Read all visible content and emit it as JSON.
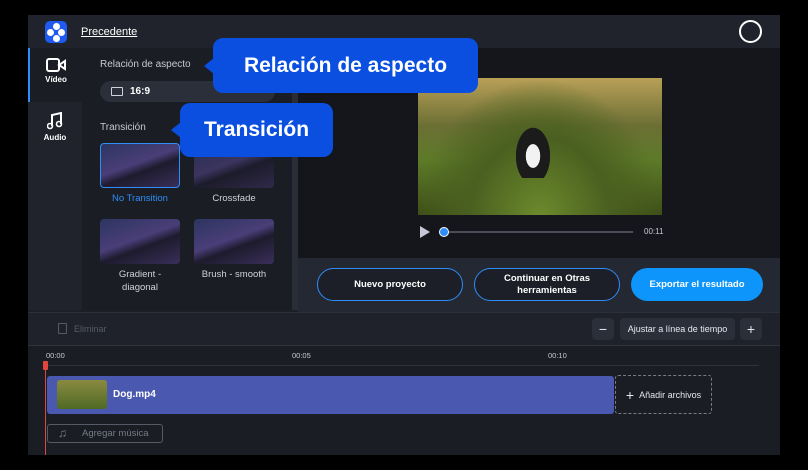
{
  "header": {
    "back_label": "Precedente"
  },
  "rail": [
    {
      "label": "Vídeo",
      "icon": "video-camera-icon"
    },
    {
      "label": "Audio",
      "icon": "music-note-icon"
    }
  ],
  "panel": {
    "aspect_label": "Relación de aspecto",
    "aspect_value": "16:9",
    "transition_label": "Transición",
    "transitions": [
      {
        "label": "No Transition",
        "selected": true
      },
      {
        "label": "Crossfade"
      },
      {
        "label": "Gradient - diagonal"
      },
      {
        "label": "Brush - smooth"
      }
    ]
  },
  "player": {
    "duration": "00:11",
    "progress": 0
  },
  "actions": {
    "new": "Nuevo proyecto",
    "continue": "Continuar en Otras herramientas",
    "export": "Exportar el resultado"
  },
  "toolbar": {
    "delete": "Eliminar",
    "fit": "Ajustar a línea de tiempo",
    "zoom_out": "−",
    "zoom_in": "+"
  },
  "timeline": {
    "ticks": [
      "00:00",
      "00:05",
      "00:10"
    ],
    "clip": "Dog.mp4",
    "add_files": "Añadir archivos",
    "add_music": "Agregar música"
  },
  "callouts": {
    "aspect": "Relación de aspecto",
    "transition": "Transición"
  },
  "colors": {
    "accent": "#2e8df7",
    "export": "#0d95fb",
    "callout": "#0a4fe0",
    "clip": "#4a58b0"
  }
}
